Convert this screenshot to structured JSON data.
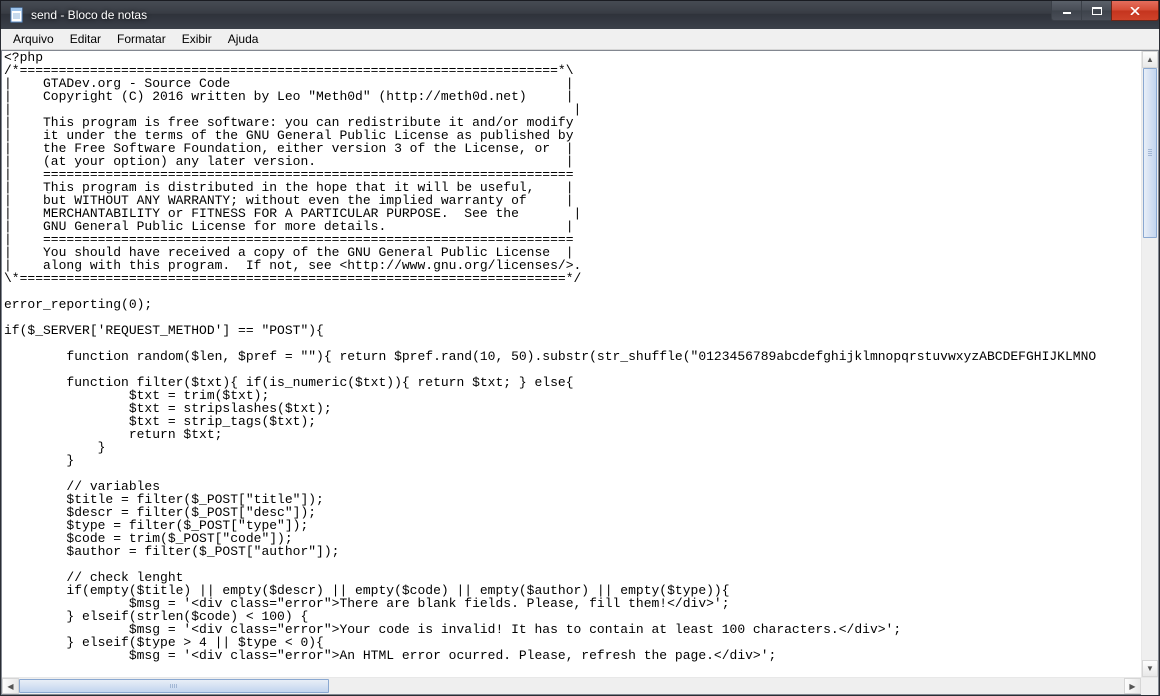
{
  "titlebar": {
    "title": "send - Bloco de notas"
  },
  "menubar": {
    "items": [
      "Arquivo",
      "Editar",
      "Formatar",
      "Exibir",
      "Ajuda"
    ]
  },
  "editor": {
    "text": "<?php\n/*=====================================================================*\\\n|    GTADev.org - Source Code                                           |\n|    Copyright (C) 2016 written by Leo \"Meth0d\" (http://meth0d.net)     |\n|                                                                        |\n|    This program is free software: you can redistribute it and/or modify\n|    it under the terms of the GNU General Public License as published by\n|    the Free Software Foundation, either version 3 of the License, or  |\n|    (at your option) any later version.                                |\n|    ====================================================================\n|    This program is distributed in the hope that it will be useful,    |\n|    but WITHOUT ANY WARRANTY; without even the implied warranty of     |\n|    MERCHANTABILITY or FITNESS FOR A PARTICULAR PURPOSE.  See the       |\n|    GNU General Public License for more details.                       |\n|    ====================================================================\n|    You should have received a copy of the GNU General Public License  |\n|    along with this program.  If not, see <http://www.gnu.org/licenses/>.\n\\*======================================================================*/\n\nerror_reporting(0);\n\nif($_SERVER['REQUEST_METHOD'] == \"POST\"){\n\n        function random($len, $pref = \"\"){ return $pref.rand(10, 50).substr(str_shuffle(\"0123456789abcdefghijklmnopqrstuvwxyzABCDEFGHIJKLMNO\n\n        function filter($txt){ if(is_numeric($txt)){ return $txt; } else{\n                $txt = trim($txt);\n                $txt = stripslashes($txt);\n                $txt = strip_tags($txt);\n                return $txt;\n            }\n        }\n\n        // variables\n        $title = filter($_POST[\"title\"]);\n        $descr = filter($_POST[\"desc\"]);\n        $type = filter($_POST[\"type\"]);\n        $code = trim($_POST[\"code\"]);\n        $author = filter($_POST[\"author\"]);\n\n        // check lenght\n        if(empty($title) || empty($descr) || empty($code) || empty($author) || empty($type)){\n                $msg = '<div class=\"error\">There are blank fields. Please, fill them!</div>';\n        } elseif(strlen($code) < 100) {\n                $msg = '<div class=\"error\">Your code is invalid! It has to contain at least 100 characters.</div>';\n        } elseif($type > 4 || $type < 0){\n                $msg = '<div class=\"error\">An HTML error ocurred. Please, refresh the page.</div>';"
  }
}
